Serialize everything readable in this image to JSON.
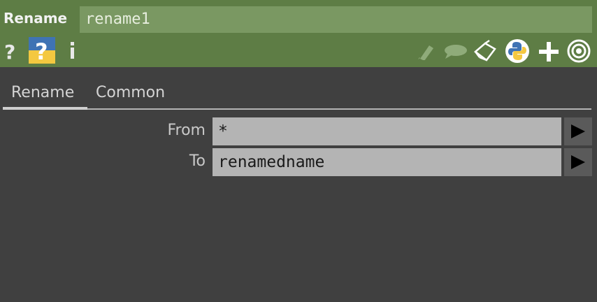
{
  "header": {
    "op_type": "Rename",
    "op_name": "rename1",
    "icons": {
      "help": "help-icon",
      "python_help": "python-help-icon",
      "info": "info-icon",
      "edit": "pencil-icon",
      "comment": "comment-bubble-icon",
      "clone": "clone-icon",
      "python": "python-icon",
      "add": "plus-icon",
      "viewer": "target-icon"
    }
  },
  "tabs": [
    {
      "label": "Rename",
      "active": true
    },
    {
      "label": "Common",
      "active": false
    }
  ],
  "params": [
    {
      "label": "From",
      "value": "*"
    },
    {
      "label": "To",
      "value": "renamedname"
    }
  ]
}
